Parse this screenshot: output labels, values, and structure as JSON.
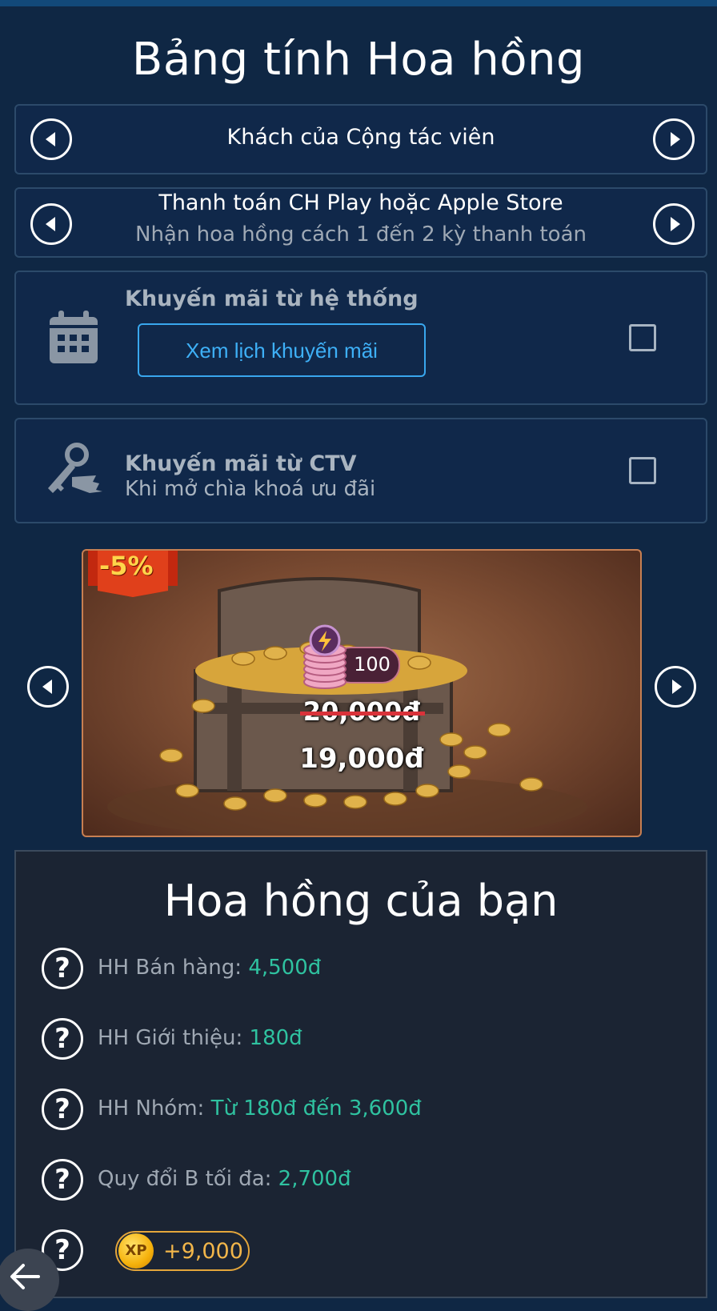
{
  "title": "Bảng tính Hoa hồng",
  "customer_type": {
    "label": "Khách của Cộng tác viên"
  },
  "payment_method": {
    "label": "Thanh toán CH Play hoặc Apple Store",
    "sub": "Nhận hoa hồng cách 1 đến 2 kỳ thanh toán"
  },
  "system_promo": {
    "title": "Khuyến mãi từ hệ thống",
    "button": "Xem lịch khuyến mãi",
    "checked": false
  },
  "ctv_promo": {
    "title": "Khuyến mãi từ CTV",
    "sub": "Khi mở chìa khoá ưu đãi",
    "checked": false
  },
  "product": {
    "discount_badge": "-5%",
    "token_amount": "100",
    "old_price": "20,000đ",
    "new_price": "19,000đ"
  },
  "commission": {
    "title": "Hoa hồng của bạn",
    "rows": [
      {
        "label": "HH Bán hàng:",
        "value": "4,500đ"
      },
      {
        "label": "HH Giới thiệu:",
        "value": "180đ"
      },
      {
        "label": "HH Nhóm:",
        "value": "Từ 180đ đến 3,600đ"
      },
      {
        "label": "Quy đổi B tối đa:",
        "value": "2,700đ"
      }
    ],
    "xp": {
      "icon_text": "XP",
      "value": "+9,000"
    }
  },
  "colors": {
    "background": "#0f2744",
    "accent_blue": "#39a7ee",
    "value_green": "#2fc2a0",
    "xp_orange": "#f2b64a"
  }
}
